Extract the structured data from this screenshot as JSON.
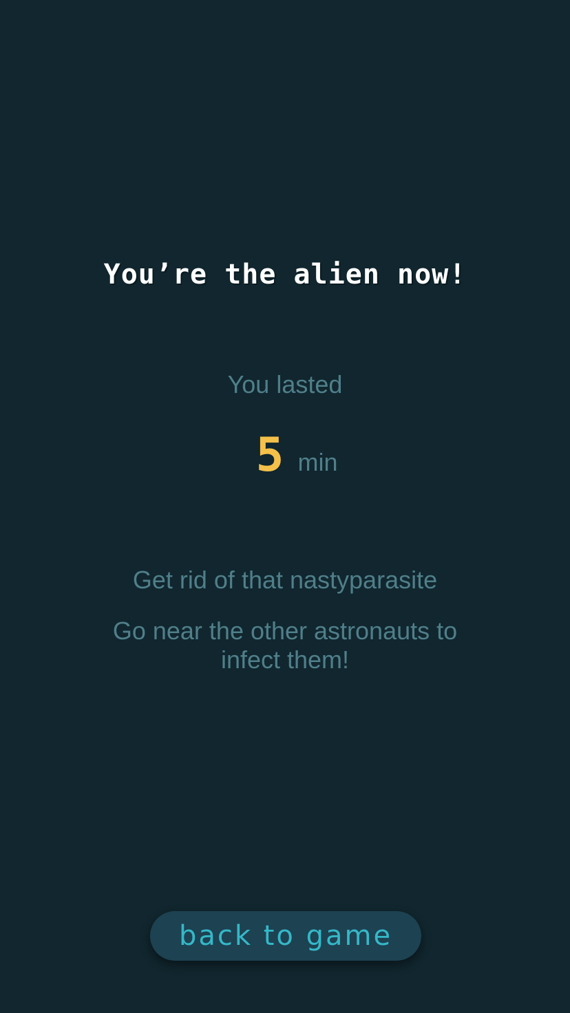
{
  "result_screen": {
    "headline": "You’re the alien now!",
    "lasted_label": "You lasted",
    "duration_value": "5",
    "duration_unit": "min",
    "goal_text": "Get rid of that nastyparasite",
    "instruction_text": "Go near the other astronauts to infect them!",
    "back_button_label": "back to game"
  },
  "colors": {
    "background": "#11262e",
    "headline": "#ffffff",
    "muted_text": "#4f7f8a",
    "duration_accent": "#f5c04a",
    "button_background": "#1d4252",
    "button_text": "#35b8c8"
  }
}
